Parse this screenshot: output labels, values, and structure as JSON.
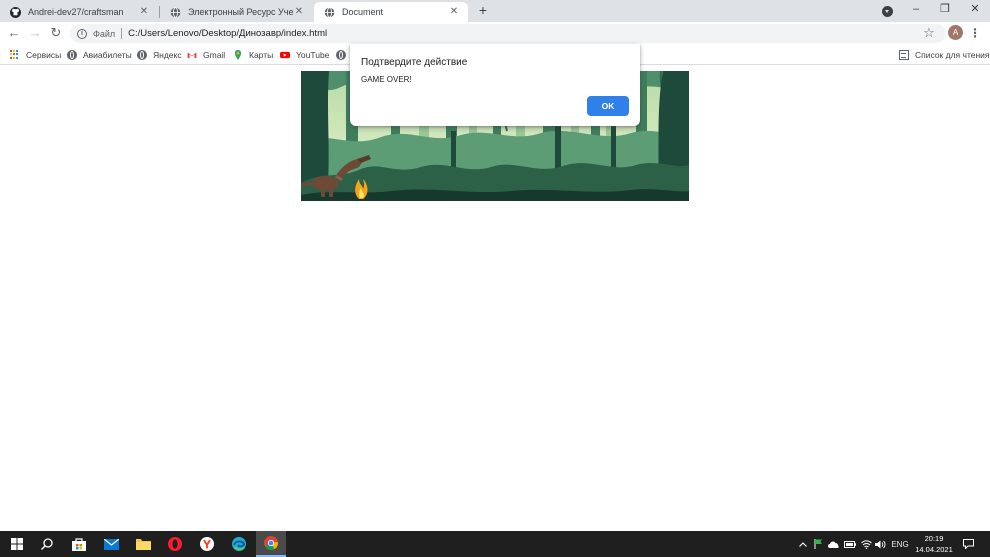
{
  "browser": {
    "tabs": [
      {
        "title": "Andrei-dev27/craftsman",
        "favicon": "github-icon",
        "active": false
      },
      {
        "title": "Электронный Ресурс Учебных Д",
        "favicon": "globe-icon",
        "active": false
      },
      {
        "title": "Document",
        "favicon": "globe-icon",
        "active": true
      }
    ],
    "new_tab": "+",
    "window_controls": {
      "minimize": "–",
      "maximize": "❐",
      "close": "✕"
    }
  },
  "toolbar": {
    "scheme_label": "Файл",
    "url": "C:/Users/Lenovo/Desktop/Динозавр/index.html",
    "avatar_letter": "A"
  },
  "bookmarks": {
    "items": [
      {
        "label": "Сервисы",
        "icon": "apps-grid-icon"
      },
      {
        "label": "Авиабилеты",
        "icon": "globe-icon"
      },
      {
        "label": "Яндекс",
        "icon": "globe-icon"
      },
      {
        "label": "Gmail",
        "icon": "gmail-icon"
      },
      {
        "label": "Карты",
        "icon": "maps-pin-icon"
      },
      {
        "label": "YouTube",
        "icon": "youtube-icon"
      }
    ],
    "reading_list": "Список для чтения"
  },
  "dialog": {
    "title": "Подтвердите действие",
    "message": "GAME OVER!",
    "ok_label": "OK"
  },
  "taskbar": {
    "apps": [
      "windows-start-icon",
      "search-icon",
      "store-icon",
      "mail-icon",
      "file-explorer-icon",
      "opera-icon",
      "yandex-browser-icon",
      "edge-icon",
      "chrome-icon"
    ],
    "language": "ENG",
    "time": "20:19",
    "date": "14.04.2021"
  },
  "colors": {
    "tabstrip_bg": "#dee1e6",
    "accent_blue": "#1a73e8",
    "jungle_dark": "#1d4a3a",
    "jungle_light": "#cfe6b8",
    "taskbar_bg": "#1f1f1f"
  }
}
